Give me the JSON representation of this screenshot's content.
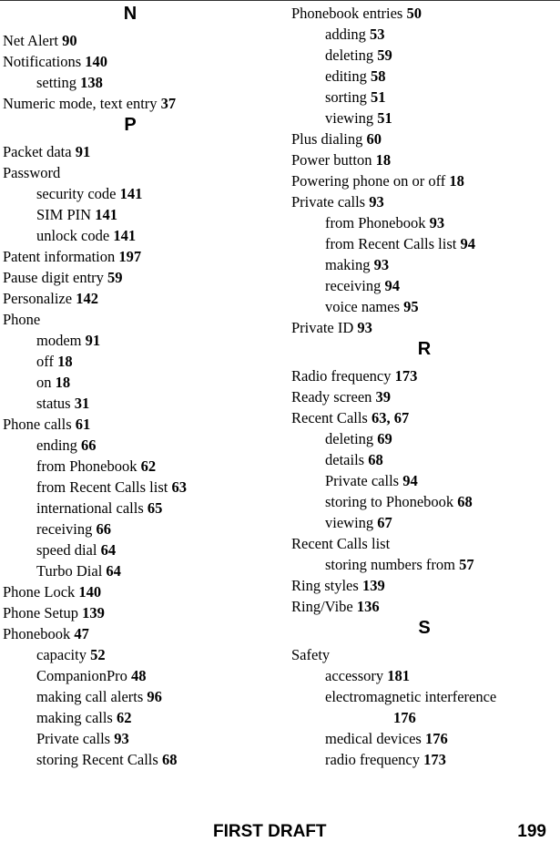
{
  "footer": {
    "draft_label": "FIRST DRAFT",
    "page_number": "199"
  },
  "left_column": {
    "sections": [
      {
        "letter": "N",
        "entries": [
          {
            "level": 1,
            "term": "Net Alert",
            "pages": "90"
          },
          {
            "level": 1,
            "term": "Notifications",
            "pages": "140"
          },
          {
            "level": 2,
            "term": "setting",
            "pages": "138"
          },
          {
            "level": 1,
            "term": "Numeric mode, text entry",
            "pages": "37"
          }
        ]
      },
      {
        "letter": "P",
        "entries": [
          {
            "level": 1,
            "term": "Packet data",
            "pages": "91"
          },
          {
            "level": 1,
            "term": "Password",
            "pages": ""
          },
          {
            "level": 2,
            "term": "security code",
            "pages": "141"
          },
          {
            "level": 2,
            "term": "SIM PIN",
            "pages": "141"
          },
          {
            "level": 2,
            "term": "unlock code",
            "pages": "141"
          },
          {
            "level": 1,
            "term": "Patent information",
            "pages": "197"
          },
          {
            "level": 1,
            "term": "Pause digit entry",
            "pages": "59"
          },
          {
            "level": 1,
            "term": "Personalize",
            "pages": "142"
          },
          {
            "level": 1,
            "term": "Phone",
            "pages": ""
          },
          {
            "level": 2,
            "term": "modem",
            "pages": "91"
          },
          {
            "level": 2,
            "term": "off",
            "pages": "18"
          },
          {
            "level": 2,
            "term": "on",
            "pages": "18"
          },
          {
            "level": 2,
            "term": "status",
            "pages": "31"
          },
          {
            "level": 1,
            "term": "Phone calls",
            "pages": "61"
          },
          {
            "level": 2,
            "term": "ending",
            "pages": "66"
          },
          {
            "level": 2,
            "term": "from Phonebook",
            "pages": "62"
          },
          {
            "level": 2,
            "term": "from Recent Calls list",
            "pages": "63"
          },
          {
            "level": 2,
            "term": "international calls",
            "pages": "65"
          },
          {
            "level": 2,
            "term": "receiving",
            "pages": "66"
          },
          {
            "level": 2,
            "term": "speed dial",
            "pages": "64"
          },
          {
            "level": 2,
            "term": "Turbo Dial",
            "pages": "64"
          },
          {
            "level": 1,
            "term": "Phone Lock",
            "pages": "140"
          },
          {
            "level": 1,
            "term": "Phone Setup",
            "pages": "139"
          },
          {
            "level": 1,
            "term": "Phonebook",
            "pages": "47"
          },
          {
            "level": 2,
            "term": "capacity",
            "pages": "52"
          },
          {
            "level": 2,
            "term": "CompanionPro",
            "pages": "48"
          },
          {
            "level": 2,
            "term": "making call alerts",
            "pages": "96"
          },
          {
            "level": 2,
            "term": "making calls",
            "pages": "62"
          },
          {
            "level": 2,
            "term": "Private calls",
            "pages": "93"
          },
          {
            "level": 2,
            "term": "storing Recent Calls",
            "pages": "68"
          }
        ]
      }
    ]
  },
  "right_column": {
    "sections": [
      {
        "letter": "",
        "entries": [
          {
            "level": 1,
            "term": "Phonebook entries",
            "pages": "50"
          },
          {
            "level": 2,
            "term": "adding",
            "pages": "53"
          },
          {
            "level": 2,
            "term": "deleting",
            "pages": "59"
          },
          {
            "level": 2,
            "term": "editing",
            "pages": "58"
          },
          {
            "level": 2,
            "term": "sorting",
            "pages": "51"
          },
          {
            "level": 2,
            "term": "viewing",
            "pages": "51"
          },
          {
            "level": 1,
            "term": "Plus dialing",
            "pages": "60"
          },
          {
            "level": 1,
            "term": "Power button",
            "pages": "18"
          },
          {
            "level": 1,
            "term": "Powering phone on or off",
            "pages": "18"
          },
          {
            "level": 1,
            "term": "Private calls",
            "pages": "93"
          },
          {
            "level": 2,
            "term": "from Phonebook",
            "pages": "93"
          },
          {
            "level": 2,
            "term": "from Recent Calls list",
            "pages": "94"
          },
          {
            "level": 2,
            "term": "making",
            "pages": "93"
          },
          {
            "level": 2,
            "term": "receiving",
            "pages": "94"
          },
          {
            "level": 2,
            "term": "voice names",
            "pages": "95"
          },
          {
            "level": 1,
            "term": "Private ID",
            "pages": "93"
          }
        ]
      },
      {
        "letter": "R",
        "entries": [
          {
            "level": 1,
            "term": "Radio frequency",
            "pages": "173"
          },
          {
            "level": 1,
            "term": "Ready screen",
            "pages": "39"
          },
          {
            "level": 1,
            "term": "Recent Calls",
            "pages": "63, 67"
          },
          {
            "level": 2,
            "term": "deleting",
            "pages": "69"
          },
          {
            "level": 2,
            "term": "details",
            "pages": "68"
          },
          {
            "level": 2,
            "term": "Private calls",
            "pages": "94"
          },
          {
            "level": 2,
            "term": "storing to Phonebook",
            "pages": "68"
          },
          {
            "level": 2,
            "term": "viewing",
            "pages": "67"
          },
          {
            "level": 1,
            "term": "Recent Calls list",
            "pages": ""
          },
          {
            "level": 2,
            "term": "storing numbers from",
            "pages": "57"
          },
          {
            "level": 1,
            "term": "Ring styles",
            "pages": "139"
          },
          {
            "level": 1,
            "term": "Ring/Vibe",
            "pages": "136"
          }
        ]
      },
      {
        "letter": "S",
        "entries": [
          {
            "level": 1,
            "term": "Safety",
            "pages": ""
          },
          {
            "level": 2,
            "term": "accessory",
            "pages": "181"
          },
          {
            "level": 2,
            "term": "electromagnetic interference",
            "pages": ""
          },
          {
            "level": 3,
            "term": "",
            "pages": "176"
          },
          {
            "level": 2,
            "term": "medical devices",
            "pages": "176"
          },
          {
            "level": 2,
            "term": "radio frequency",
            "pages": "173"
          }
        ]
      }
    ]
  }
}
